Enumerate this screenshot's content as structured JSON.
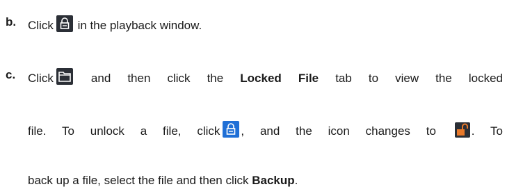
{
  "steps": [
    {
      "marker": "b.",
      "lines": [
        {
          "before": "Click",
          "icon": "lock-icon",
          "after": "in the playback window."
        }
      ]
    },
    {
      "marker": "c.",
      "line1": {
        "before": "Click",
        "icon": "folder-icon",
        "mid": "and then click the",
        "bold": "Locked File",
        "after": "tab to view the locked"
      },
      "line2": {
        "before": "file. To unlock a file, click",
        "icon": "locked-blue-icon",
        "mid": ", and the icon changes to",
        "icon2": "unlocked-icon",
        "after": ". To"
      },
      "line3": {
        "before": "back up a file, select the file and then click",
        "bold": "Backup",
        "after": "."
      }
    }
  ],
  "colors": {
    "icon_dark_bg": "#2b2f36",
    "icon_blue": "#1f6fd6",
    "icon_unlock_orange": "#e8792a"
  }
}
